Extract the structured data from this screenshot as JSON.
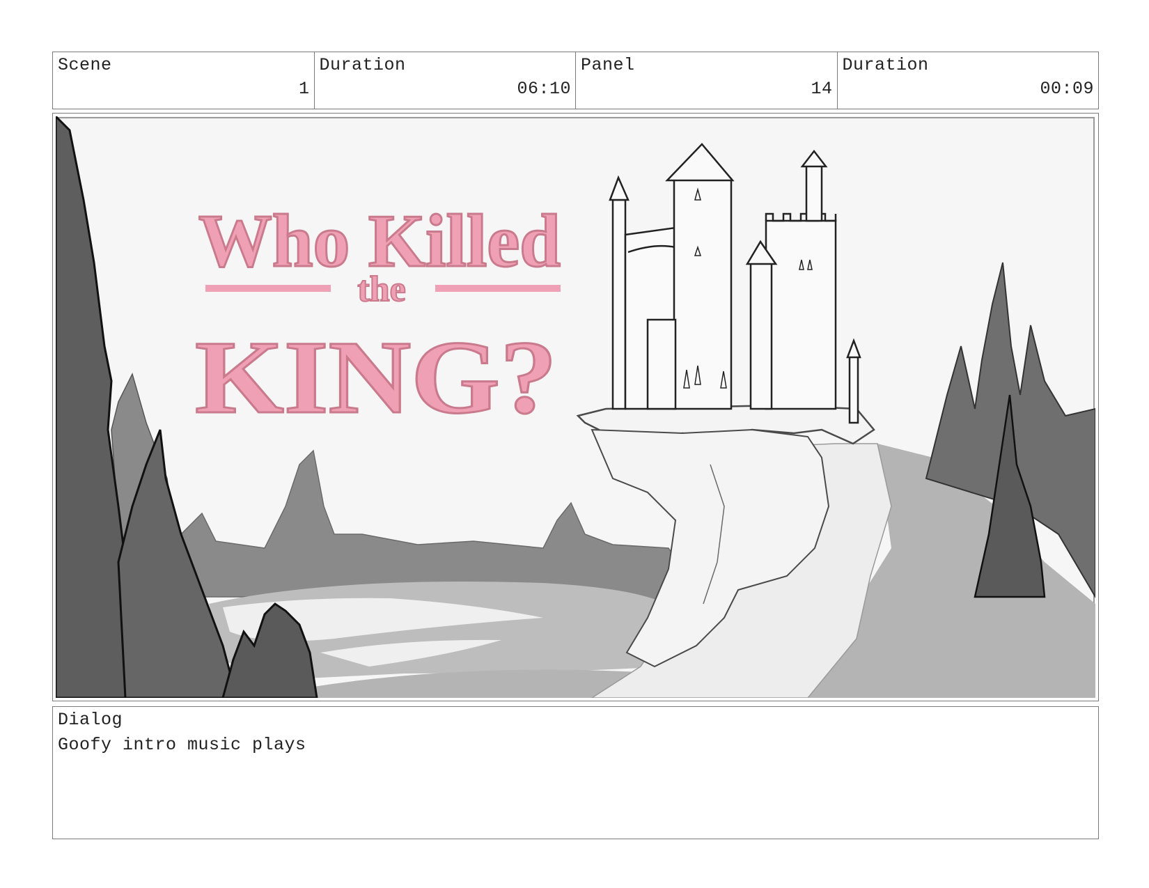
{
  "header": {
    "scene_label": "Scene",
    "scene_value": "1",
    "scene_duration_label": "Duration",
    "scene_duration_value": "06:10",
    "panel_label": "Panel",
    "panel_value": "14",
    "panel_duration_label": "Duration",
    "panel_duration_value": "00:09"
  },
  "artwork": {
    "title_line1": "Who Killed",
    "title_line2": "the",
    "title_line3": "KING?",
    "title_color": "#f0a0b4",
    "title_outline_color": "#c97a8c"
  },
  "dialog": {
    "label": "Dialog",
    "text": "Goofy intro music plays"
  }
}
